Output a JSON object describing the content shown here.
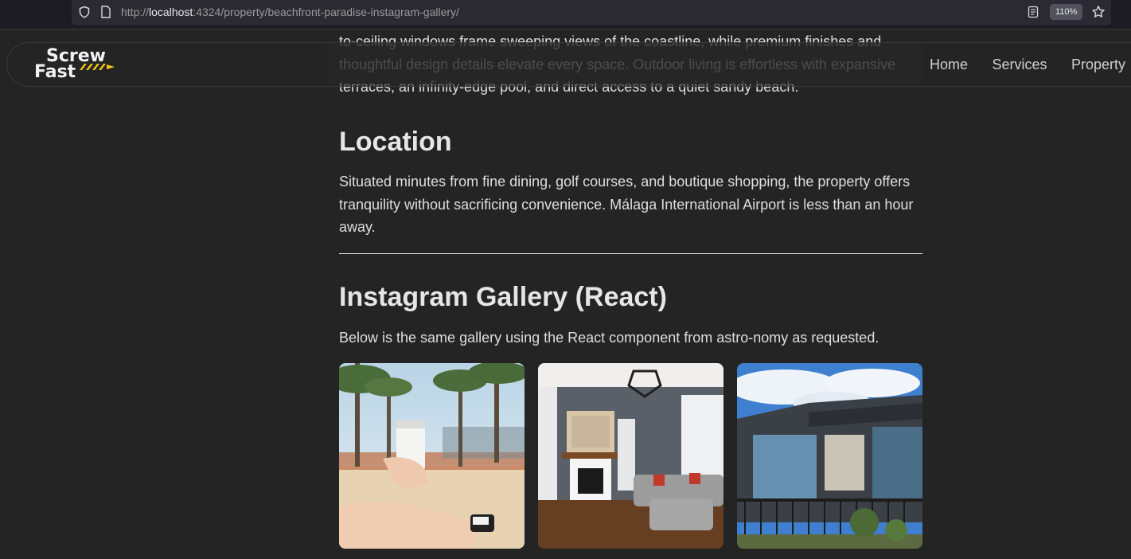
{
  "browser": {
    "url_prefix": "http://",
    "url_host": "localhost",
    "url_rest": ":4324/property/beachfront-paradise-instagram-gallery/",
    "zoom": "110%"
  },
  "logo": {
    "line1": "Screw",
    "line2": "Fast",
    "accent_color": "#f5c518"
  },
  "nav": {
    "items": [
      {
        "label": "Home"
      },
      {
        "label": "Services"
      },
      {
        "label": "Property"
      }
    ]
  },
  "content": {
    "intro_paragraph": "to-ceiling windows frame sweeping views of the coastline, while premium finishes and thoughtful design details elevate every space. Outdoor living is effortless with expansive terraces, an infinity-edge pool, and direct access to a quiet sandy beach.",
    "location_heading": "Location",
    "location_paragraph": "Situated minutes from fine dining, golf courses, and boutique shopping, the property offers tranquility without sacrificing convenience. Málaga International Airport is less than an hour away.",
    "gallery_heading": "Instagram Gallery (React)",
    "gallery_paragraph": "Below is the same gallery using the React component from astro-nomy as requested."
  },
  "gallery": {
    "images": [
      {
        "subject": "beach-palm-trees-drink-carton"
      },
      {
        "subject": "living-room-fireplace-sofa"
      },
      {
        "subject": "modern-house-exterior-blue-sky"
      }
    ]
  },
  "colors": {
    "background": "#242424",
    "text": "#dedede"
  }
}
